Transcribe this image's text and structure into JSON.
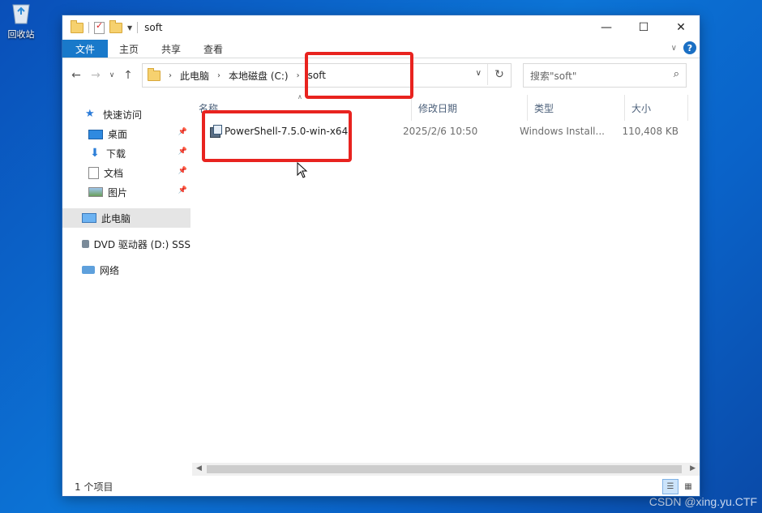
{
  "desktop": {
    "recycle_bin_label": "回收站",
    "watermark": "CSDN @xing.yu.CTF"
  },
  "window": {
    "title": "soft",
    "controls": {
      "minimize": "—",
      "maximize": "☐",
      "close": "✕"
    }
  },
  "ribbon": {
    "tabs": [
      "文件",
      "主页",
      "共享",
      "查看"
    ],
    "help": "?"
  },
  "address": {
    "breadcrumbs": [
      "此电脑",
      "本地磁盘 (C:)",
      "soft"
    ],
    "search_placeholder": "搜索\"soft\""
  },
  "sidebar": {
    "items": [
      {
        "label": "快速访问"
      },
      {
        "label": "桌面"
      },
      {
        "label": "下载"
      },
      {
        "label": "文档"
      },
      {
        "label": "图片"
      },
      {
        "label": "此电脑"
      },
      {
        "label": "DVD 驱动器 (D:) SSS"
      },
      {
        "label": "网络"
      }
    ]
  },
  "columns": {
    "name": "名称",
    "modified": "修改日期",
    "type": "类型",
    "size": "大小"
  },
  "files": [
    {
      "name": "PowerShell-7.5.0-win-x64",
      "modified": "2025/2/6 10:50",
      "type": "Windows Install...",
      "size": "110,408 KB"
    }
  ],
  "status": {
    "count": "1 个项目"
  },
  "colors": {
    "highlight": "#e8231f",
    "file_tab": "#1979ca",
    "desktop": "#0c74d6"
  }
}
